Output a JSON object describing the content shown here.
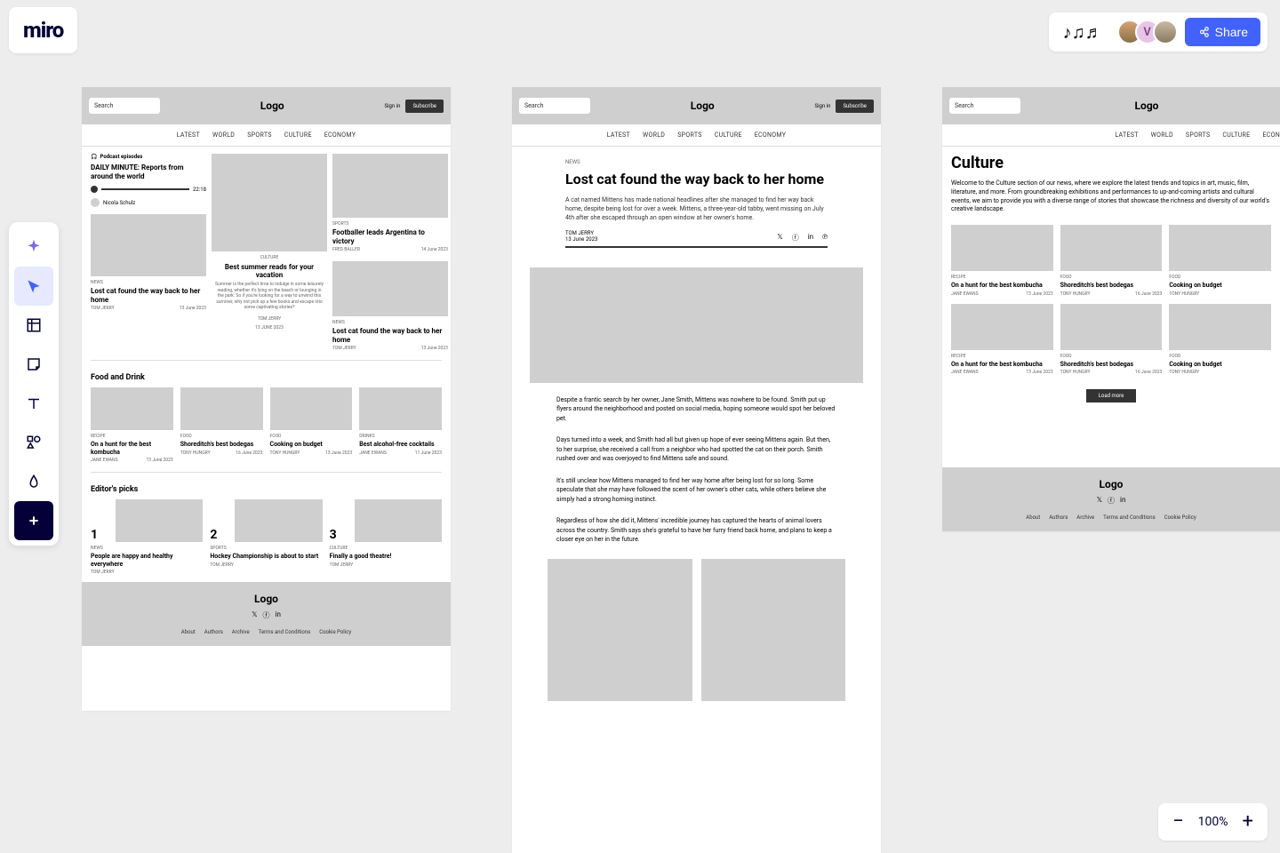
{
  "app": {
    "logo": "miro",
    "share": "Share",
    "reactions": "♪♫♬",
    "zoom": "100%"
  },
  "avatars": [
    "",
    "V",
    ""
  ],
  "wf": {
    "search": "Search",
    "logo": "Logo",
    "signin": "Sign in",
    "subscribe": "Subscribe",
    "nav": [
      "LATEST",
      "WORLD",
      "SPORTS",
      "CULTURE",
      "ECONOMY"
    ],
    "podcast": {
      "label": "Podcast episodes",
      "title": "DAILY MINUTE: Reports from around the world",
      "time": "22:18",
      "author": "Nicola Schulz"
    },
    "stories": {
      "lost_cat": {
        "cat": "NEWS",
        "title": "Lost cat found the way back to her home",
        "author": "TOM JERRY",
        "date": "13 June 2023"
      },
      "footballer": {
        "cat": "SPORTS",
        "title": "Footballer leads Argentina to victory",
        "author": "FRED BALLER",
        "date": "14 June 2023"
      },
      "summer": {
        "cat": "CULTURE",
        "title": "Best summer reads for your vacation",
        "desc": "Summer is the perfect time to indulge in some leisurely reading, whether it's lying on the beach or lounging in the park. So if you're looking for a way to unwind this summer, why not pick up a few books and escape into some captivating stories?",
        "author": "TOM JERRY",
        "date": "13 June 2023"
      }
    },
    "food_title": "Food and Drink",
    "food": [
      {
        "cat": "RECIPE",
        "title": "On a hunt for the best kombucha",
        "author": "JANE EWANS",
        "date": "13 June 2023"
      },
      {
        "cat": "FOOD",
        "title": "Shoreditch's best bodegas",
        "author": "TONY HUNGRY",
        "date": "16 June 2023"
      },
      {
        "cat": "FOOD",
        "title": "Cooking on budget",
        "author": "TONY HUNGRY",
        "date": "13 June 2023"
      },
      {
        "cat": "DRINKS",
        "title": "Best alcohol-free cocktails",
        "author": "JANE EWANS",
        "date": "11 June 2023"
      }
    ],
    "editor_title": "Editor's picks",
    "editors": [
      {
        "n": "1",
        "cat": "NEWS",
        "title": "People are happy and healthy everywhere",
        "author": "TOM JERRY"
      },
      {
        "n": "2",
        "cat": "SPORTS",
        "title": "Hockey Championship is about to start",
        "author": "TOM JERRY"
      },
      {
        "n": "3",
        "cat": "CULTURE",
        "title": "Finally a good theatre!",
        "author": "TOM JERRY"
      }
    ],
    "footer_links": [
      "About",
      "Authors",
      "Archive",
      "Terms and Conditions",
      "Cookie Policy"
    ]
  },
  "article": {
    "cat": "NEWS",
    "title": "Lost cat found the way back to her home",
    "lead": "A cat named Mittens has made national headlines after she managed to find her way back home, despite being lost for over a week. Mittens, a three-year-old tabby, went missing on July 4th after she escaped through an open window at her owner's home.",
    "author": "TOM JERRY",
    "date": "13 June 2023",
    "p1": "Despite a frantic search by her owner, Jane Smith, Mittens was nowhere to be found. Smith put up flyers around the neighborhood and posted on social media, hoping someone would spot her beloved pet.",
    "p2": "Days turned into a week, and Smith had all but given up hope of ever seeing Mittens again. But then, to her surprise, she received a call from a neighbor who had spotted the cat on their porch. Smith rushed over and was overjoyed to find Mittens safe and sound.",
    "p3": "It's still unclear how Mittens managed to find her way home after being lost for so long. Some speculate that she may have followed the scent of her owner's other cats, while others believe she simply had a strong homing instinct.",
    "p4": "Regardless of how she did it, Mittens' incredible journey has captured the hearts of animal lovers across the country. Smith says she's grateful to have her furry friend back home, and plans to keep a closer eye on her in the future."
  },
  "culture": {
    "title": "Culture",
    "intro": "Welcome to the Culture section of our news, where we explore the latest trends and topics in art, music, film, literature, and more. From groundbreaking exhibitions and performances to up-and-coming artists and cultural events, we aim to provide you with a diverse range of stories that showcase the richness and diversity of our world's creative landscape.",
    "cards": [
      {
        "cat": "RECIPE",
        "title": "On a hunt for the best kombucha",
        "author": "JANE EWANS",
        "date": "13 June 2023"
      },
      {
        "cat": "FOOD",
        "title": "Shoreditch's best bodegas",
        "author": "TONY HUNGRY",
        "date": "16 June 2023"
      },
      {
        "cat": "FOOD",
        "title": "Cooking on budget",
        "author": "TONY HUNGRY",
        "date": ""
      },
      {
        "cat": "RECIPE",
        "title": "On a hunt for the best kombucha",
        "author": "JANE EWANS",
        "date": "13 June 2023"
      },
      {
        "cat": "FOOD",
        "title": "Shoreditch's best bodegas",
        "author": "TONY HUNGRY",
        "date": "16 June 2023"
      },
      {
        "cat": "FOOD",
        "title": "Cooking on budget",
        "author": "TONY HUNGRY",
        "date": ""
      }
    ],
    "load_more": "Load more"
  }
}
